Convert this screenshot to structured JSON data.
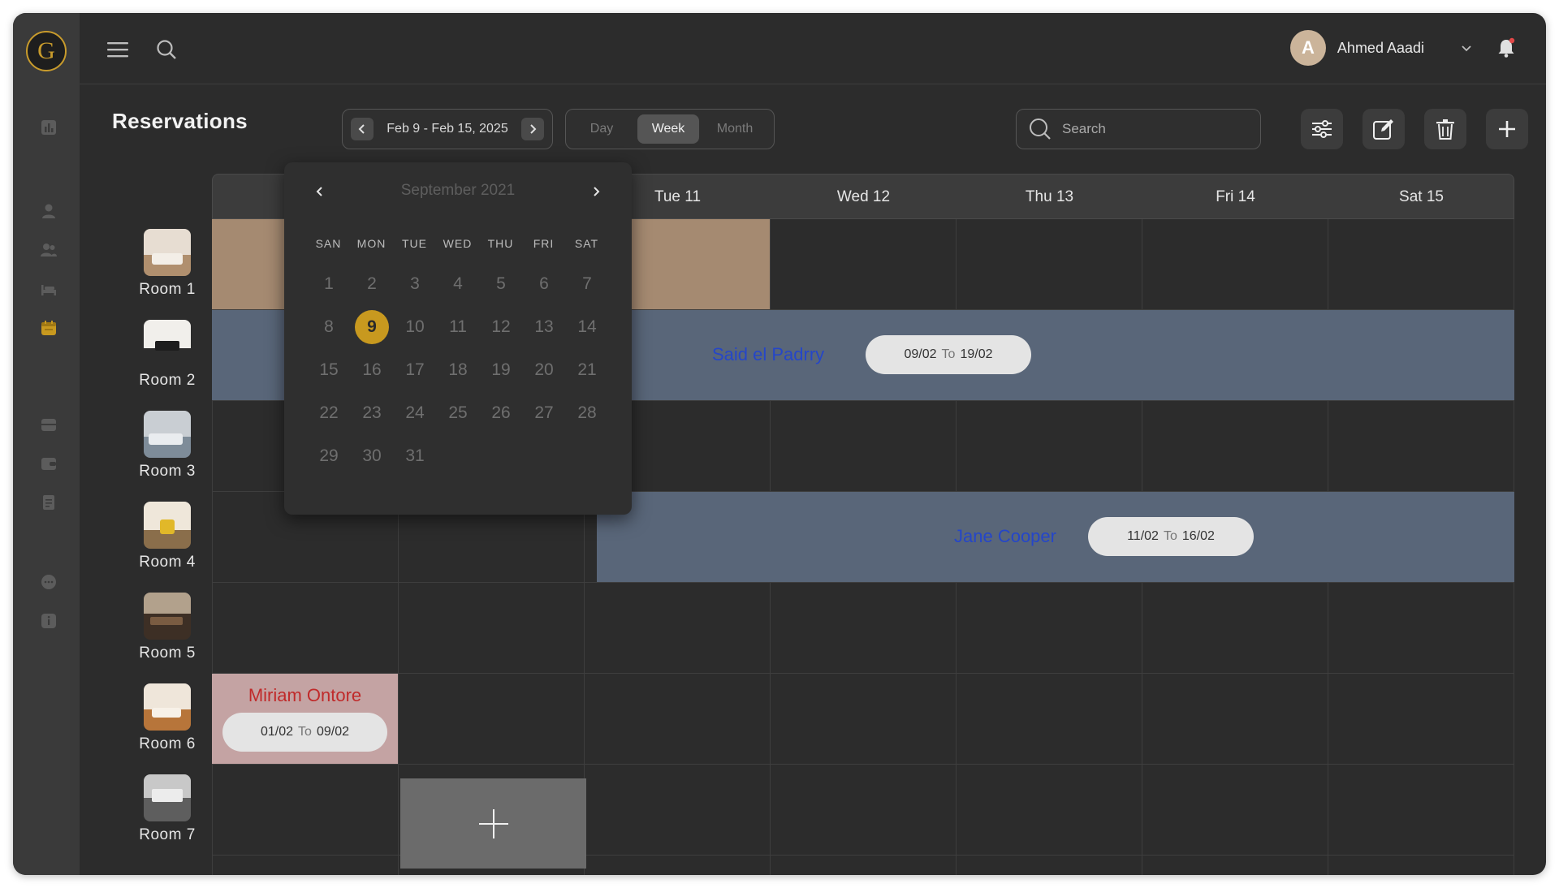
{
  "app": {
    "logo_letter": "G",
    "accent": "#c8991f"
  },
  "user": {
    "initial": "A",
    "name": "Ahmed Aaadi"
  },
  "page": {
    "title": "Reservations"
  },
  "date_range": {
    "label": "Feb 9 - Feb 15, 2025"
  },
  "views": {
    "day": "Day",
    "week": "Week",
    "month": "Month",
    "active": "Week"
  },
  "search": {
    "placeholder": "Search"
  },
  "week_days": [
    "Tue 11",
    "Wed 12",
    "Thu 13",
    "Fri 14",
    "Sat 15"
  ],
  "rooms": [
    "Room 1",
    "Room 2",
    "Room 3",
    "Room 4",
    "Room 5",
    "Room 6",
    "Room 7"
  ],
  "bookings": {
    "said": {
      "guest": "Said el Padrry",
      "from": "09/02",
      "to_word": "To",
      "to": "19/02",
      "color": "#596679",
      "text_color": "#2546c8"
    },
    "jane": {
      "guest": "Jane Cooper",
      "from": "11/02",
      "to_word": "To",
      "to": "16/02",
      "color": "#596679",
      "text_color": "#2546c8"
    },
    "miriam": {
      "guest": "Miriam Ontore",
      "from": "01/02",
      "to_word": "To",
      "to": "09/02",
      "color": "#c4a3a3",
      "text_color": "#c02a2a"
    },
    "room1": {
      "color": "#a58a71"
    }
  },
  "datepicker": {
    "month_label": "September 2021",
    "weekdays": [
      "SAN",
      "MON",
      "TUE",
      "WED",
      "THU",
      "FRI",
      "SAT"
    ],
    "days": [
      "1",
      "2",
      "3",
      "4",
      "5",
      "6",
      "7",
      "8",
      "9",
      "10",
      "11",
      "12",
      "13",
      "14",
      "15",
      "16",
      "17",
      "18",
      "19",
      "20",
      "21",
      "22",
      "23",
      "24",
      "25",
      "26",
      "27",
      "28",
      "29",
      "30",
      "31"
    ],
    "selected": "9"
  }
}
